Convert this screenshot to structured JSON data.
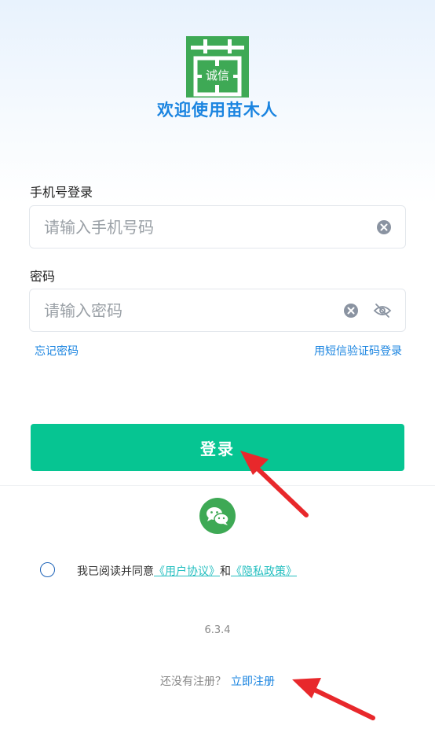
{
  "header": {
    "logo_text": "诚信",
    "title": "欢迎使用苗木人"
  },
  "phone": {
    "label": "手机号登录",
    "placeholder": "请输入手机号码",
    "value": ""
  },
  "password": {
    "label": "密码",
    "placeholder": "请输入密码",
    "value": ""
  },
  "links": {
    "forgot": "忘记密码",
    "sms_login": "用短信验证码登录"
  },
  "login_button": "登录",
  "agreement": {
    "prefix": "我已阅读并同意",
    "user_agreement": "《用户协议》",
    "and": "和",
    "privacy_policy": "《隐私政策》"
  },
  "version": "6.3.4",
  "register": {
    "prompt": "还没有注册？",
    "link": "立即注册"
  },
  "colors": {
    "primary_button": "#06c592",
    "link": "#1a84e0",
    "title": "#1a84e0",
    "logo_bg": "#3ea955",
    "wechat": "#3ea955",
    "agreement_link": "#25bfc0",
    "annotation_arrow": "#e8282b"
  },
  "icons": {
    "logo": "miao-logo-icon",
    "clear": "clear-icon",
    "visibility": "eye-off-icon",
    "wechat": "wechat-icon",
    "radio": "radio-icon",
    "arrow": "red-arrow-icon"
  }
}
